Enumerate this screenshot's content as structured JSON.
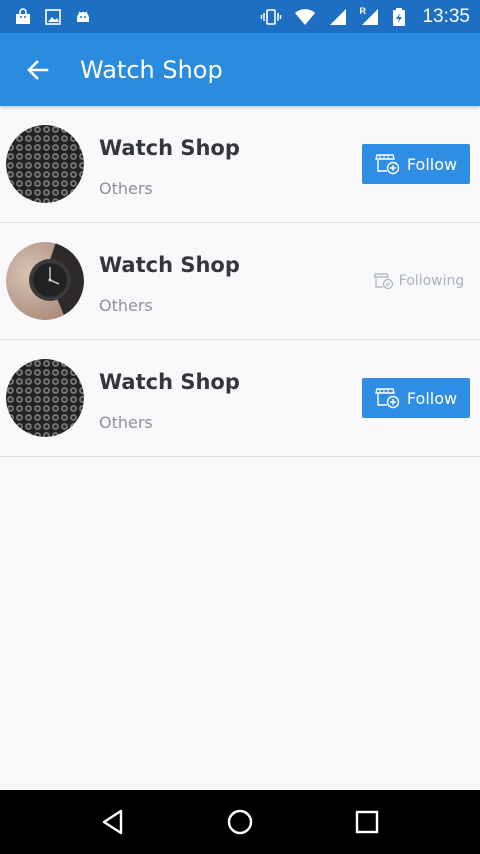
{
  "status_bar": {
    "time": "13:35",
    "roaming_label": "R"
  },
  "app_bar": {
    "title": "Watch Shop"
  },
  "shops": [
    {
      "name": "Watch Shop",
      "category": "Others",
      "action": "Follow",
      "avatar": "watch-grid-image"
    },
    {
      "name": "Watch Shop",
      "category": "Others",
      "action": "Following",
      "avatar": "black-watch-image"
    },
    {
      "name": "Watch Shop",
      "category": "Others",
      "action": "Follow",
      "avatar": "watch-grid-image"
    }
  ],
  "colors": {
    "status_bar": "#1c6fc3",
    "app_bar": "#2b8bde",
    "follow_button": "#2f8ee3",
    "following_text": "#a9b2c0"
  },
  "nav": {
    "back": "back-triangle-icon",
    "home": "home-circle-icon",
    "recents": "recents-square-icon"
  }
}
